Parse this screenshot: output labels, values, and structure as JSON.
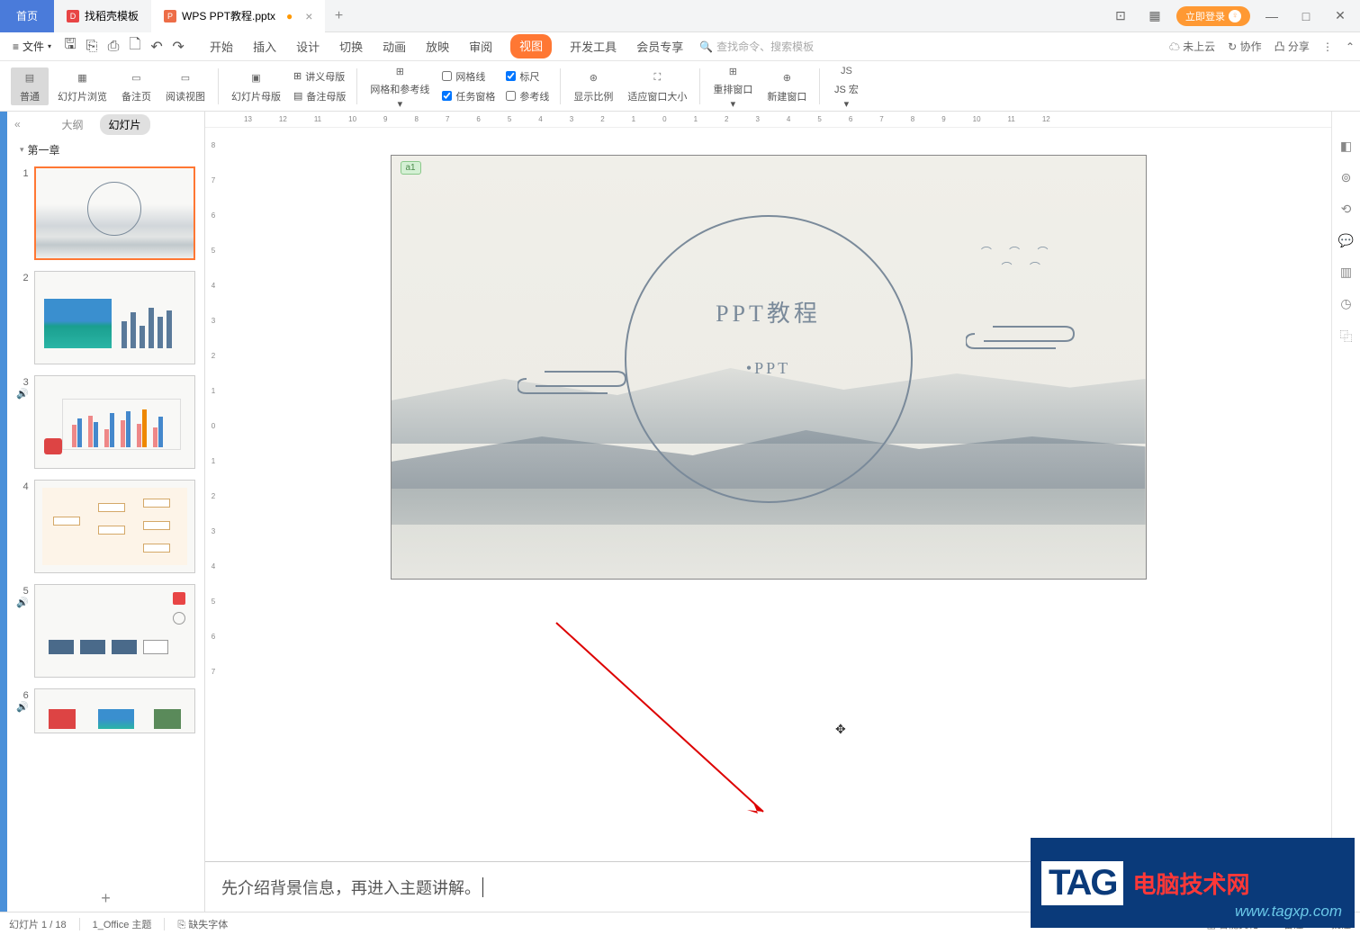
{
  "titlebar": {
    "home": "首页",
    "doke": "找稻壳模板",
    "doc": "WPS PPT教程.pptx",
    "login": "立即登录"
  },
  "menubar": {
    "file": "文件",
    "tabs": [
      "开始",
      "插入",
      "设计",
      "切换",
      "动画",
      "放映",
      "审阅",
      "视图",
      "开发工具",
      "会员专享"
    ],
    "active_idx": 7,
    "search_placeholder": "查找命令、搜索模板",
    "cloud": "未上云",
    "coop": "协作",
    "share": "分享"
  },
  "ribbon": {
    "normal": "普通",
    "browse": "幻灯片浏览",
    "notes": "备注页",
    "reading": "阅读视图",
    "slide_master": "幻灯片母版",
    "handout_master": "讲义母版",
    "notes_master": "备注母版",
    "grid_guides": "网格和参考线",
    "gridlines": "网格线",
    "ruler": "标尺",
    "task_pane": "任务窗格",
    "guides": "参考线",
    "zoom": "显示比例",
    "fit": "适应窗口大小",
    "arrange": "重排窗口",
    "new_win": "新建窗口",
    "jsmacro": "JS 宏"
  },
  "sidebar": {
    "outline": "大纲",
    "slides": "幻灯片",
    "chapter": "第一章"
  },
  "slide": {
    "tag": "a1",
    "title": "PPT教程",
    "sub": "•PPT"
  },
  "notes_text": "先介绍背景信息，再进入主题讲解。",
  "status": {
    "slide": "幻灯片 1 / 18",
    "theme": "1_Office 主题",
    "missing_font": "缺失字体",
    "beautify": "智能美化",
    "notes": "备注",
    "comment": "批注"
  },
  "tag": {
    "logo": "TAG",
    "cn": "电脑技术网",
    "url": "www.tagxp.com"
  },
  "ruler_h": [
    "13",
    "12",
    "11",
    "10",
    "9",
    "8",
    "7",
    "6",
    "5",
    "4",
    "3",
    "2",
    "1",
    "0",
    "1",
    "2",
    "3",
    "4",
    "5",
    "6",
    "7",
    "8",
    "9",
    "10",
    "11",
    "12"
  ],
  "ruler_v": [
    "8",
    "7",
    "6",
    "5",
    "4",
    "3",
    "2",
    "1",
    "0",
    "1",
    "2",
    "3",
    "4",
    "5",
    "6",
    "7"
  ]
}
